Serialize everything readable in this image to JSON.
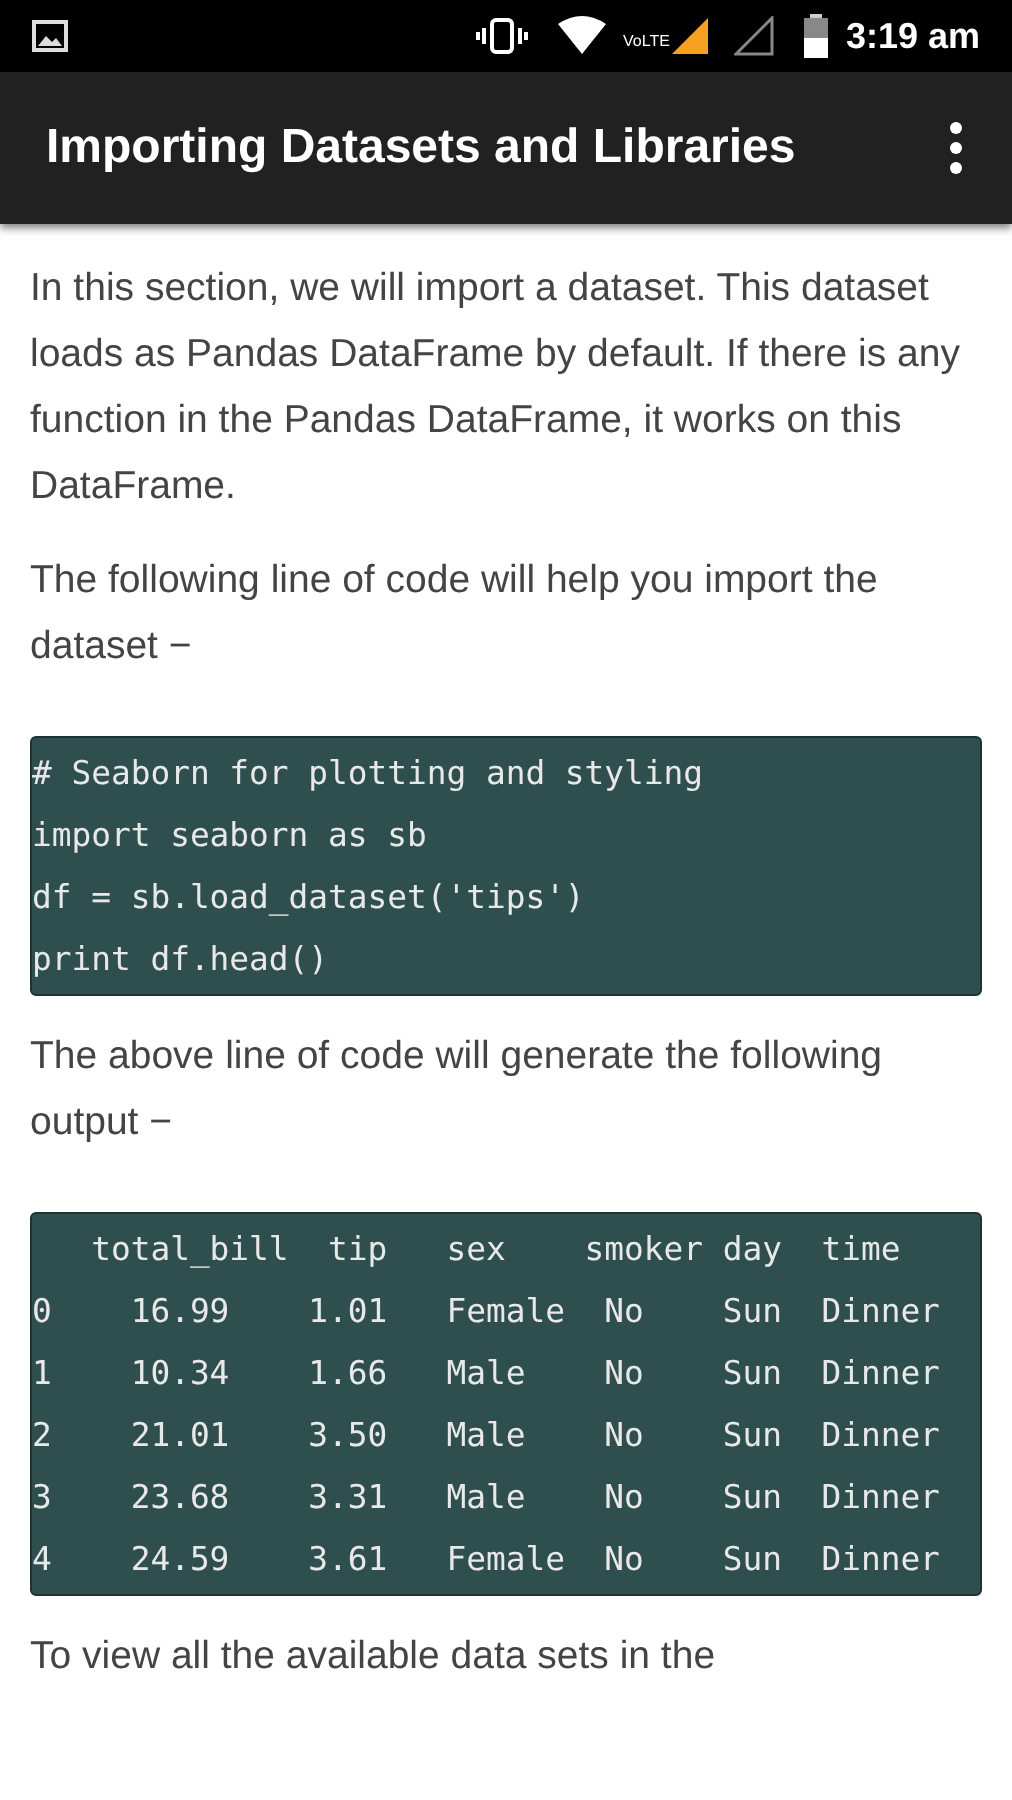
{
  "status_bar": {
    "network_label": "VoLTE",
    "time": "3:19 am"
  },
  "app_bar": {
    "title": "Importing Datasets and Libraries"
  },
  "content": [
    {
      "kind": "paragraph",
      "text": "In this section, we will import a dataset. This dataset loads as Pandas DataFrame by default. If there is any function in the Pandas DataFrame, it works on this DataFrame."
    },
    {
      "kind": "paragraph",
      "text": "The following line of code will help you import the dataset −"
    },
    {
      "kind": "code",
      "lines": [
        "# Seaborn for plotting and styling",
        "import seaborn as sb",
        "df = sb.load_dataset('tips')",
        "print df.head()"
      ]
    },
    {
      "kind": "paragraph",
      "text": "The above line of code will generate the following output −"
    },
    {
      "kind": "code",
      "lines": [
        "   total_bill  tip   sex    smoker day  time",
        "0    16.99    1.01   Female  No    Sun  Dinner",
        "1    10.34    1.66   Male    No    Sun  Dinner",
        "2    21.01    3.50   Male    No    Sun  Dinner",
        "3    23.68    3.31   Male    No    Sun  Dinner",
        "4    24.59    3.61   Female  No    Sun  Dinner"
      ]
    },
    {
      "kind": "paragraph",
      "text": "To view all the available data sets in the"
    }
  ]
}
